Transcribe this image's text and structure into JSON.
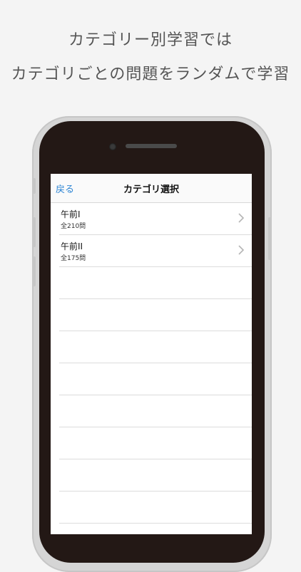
{
  "captions": {
    "line1": "カテゴリー別学習では",
    "line2": "カテゴリごとの問題をランダムで学習"
  },
  "navbar": {
    "back_label": "戻る",
    "title": "カテゴリ選択"
  },
  "categories": [
    {
      "title": "午前I",
      "count": "全210問"
    },
    {
      "title": "午前II",
      "count": "全175問"
    }
  ],
  "colors": {
    "background": "#f4f4f4",
    "phone_frame": "#d5d5d5",
    "phone_face": "#231815",
    "link_blue": "#2f86d4"
  },
  "icons": {
    "row_accessory": "chevron-right-icon"
  }
}
